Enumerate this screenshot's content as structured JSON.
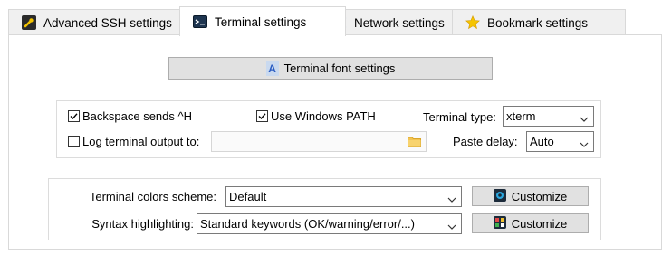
{
  "tabs": [
    {
      "label": "Advanced SSH settings",
      "icon": "wrench-icon"
    },
    {
      "label": "Terminal settings",
      "icon": "terminal-icon",
      "active": true
    },
    {
      "label": "Network settings",
      "icon": "network-icon"
    },
    {
      "label": "Bookmark settings",
      "icon": "star-icon"
    }
  ],
  "font_button": {
    "label": "Terminal font settings",
    "icon": "font-icon"
  },
  "options": {
    "backspace": {
      "label": "Backspace sends ^H",
      "checked": true
    },
    "windows_path": {
      "label": "Use Windows PATH",
      "checked": true
    },
    "terminal_type": {
      "label": "Terminal type:",
      "value": "xterm"
    },
    "log_output": {
      "label": "Log terminal output to:",
      "checked": false,
      "value": ""
    },
    "paste_delay": {
      "label": "Paste delay:",
      "value": "Auto"
    }
  },
  "colors": {
    "scheme": {
      "label": "Terminal colors scheme:",
      "value": "Default",
      "button": "Customize"
    },
    "syntax": {
      "label": "Syntax highlighting:",
      "value": "Standard keywords (OK/warning/error/...)",
      "button": "Customize"
    }
  }
}
